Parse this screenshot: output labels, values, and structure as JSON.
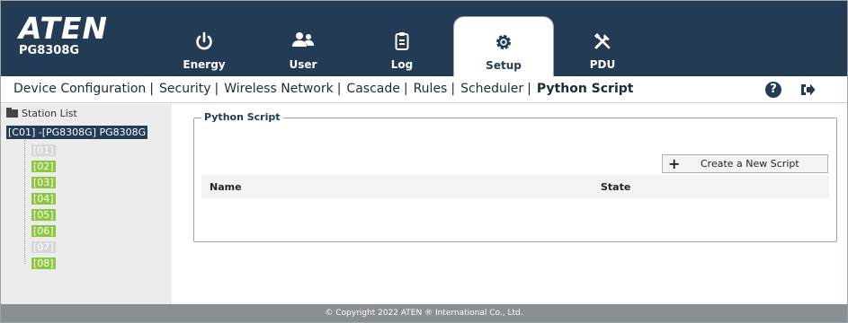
{
  "header": {
    "logo_text": "ATEN",
    "model": "PG8308G",
    "tabs": [
      {
        "label": "Energy",
        "icon": "power-icon"
      },
      {
        "label": "User",
        "icon": "users-icon"
      },
      {
        "label": "Log",
        "icon": "log-icon"
      },
      {
        "label": "Setup",
        "icon": "gear-icon",
        "active": true
      },
      {
        "label": "PDU",
        "icon": "tools-icon"
      }
    ]
  },
  "subnav": {
    "items": [
      "Device Configuration",
      "Security",
      "Wireless Network",
      "Cascade",
      "Rules",
      "Scheduler",
      "Python Script"
    ],
    "separator": "|",
    "current": "Python Script",
    "help_label": "?"
  },
  "sidebar": {
    "title": "Station List",
    "root": "[C01] -[PG8308G] PG8308G",
    "ports": [
      {
        "label": "[01]",
        "state": "off"
      },
      {
        "label": "[02]",
        "state": "on"
      },
      {
        "label": "[03]",
        "state": "on"
      },
      {
        "label": "[04]",
        "state": "on"
      },
      {
        "label": "[05]",
        "state": "on"
      },
      {
        "label": "[06]",
        "state": "on"
      },
      {
        "label": "[07]",
        "state": "off"
      },
      {
        "label": "[08]",
        "state": "on"
      }
    ]
  },
  "main": {
    "legend": "Python Script",
    "create_button": "Create a New Script",
    "columns": [
      "Name",
      "State"
    ],
    "rows": []
  },
  "footer": {
    "copyright": "© Copyright 2022 ATEN ® International Co., Ltd."
  },
  "colors": {
    "header_bg": "#243b55",
    "port_on": "#8dc63f",
    "port_off": "#d7d7d7",
    "footer_bg": "#8a8f94"
  }
}
